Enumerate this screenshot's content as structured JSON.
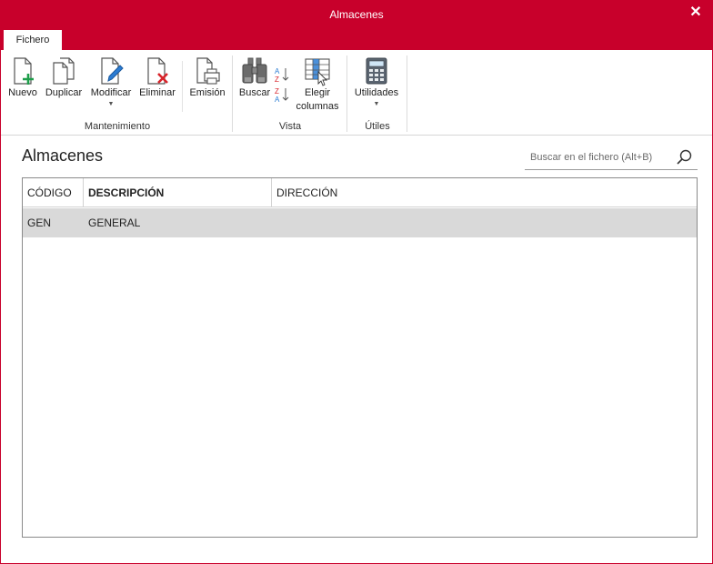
{
  "window": {
    "title": "Almacenes",
    "close_glyph": "✕"
  },
  "tabs": [
    {
      "label": "Fichero"
    }
  ],
  "ribbon": {
    "groups": [
      {
        "label": "Mantenimiento"
      },
      {
        "label": "Vista"
      },
      {
        "label": "Útiles"
      }
    ],
    "buttons": {
      "nuevo": {
        "label": "Nuevo",
        "icon": "new-document-icon"
      },
      "duplicar": {
        "label": "Duplicar",
        "icon": "duplicate-icon"
      },
      "modificar": {
        "label": "Modificar",
        "icon": "edit-document-icon"
      },
      "eliminar": {
        "label": "Eliminar",
        "icon": "delete-document-icon"
      },
      "emision": {
        "label": "Emisión",
        "icon": "print-icon"
      },
      "buscar": {
        "label": "Buscar",
        "icon": "binoculars-icon"
      },
      "sort_asc": {
        "icon": "sort-ascending-icon"
      },
      "sort_desc": {
        "icon": "sort-descending-icon"
      },
      "elegir_columnas": {
        "label_line1": "Elegir",
        "label_line2": "columnas",
        "icon": "choose-columns-icon"
      },
      "utilidades": {
        "label": "Utilidades",
        "icon": "calculator-icon"
      }
    }
  },
  "page": {
    "heading": "Almacenes"
  },
  "search": {
    "placeholder": "Buscar en el fichero (Alt+B)",
    "value": ""
  },
  "table": {
    "columns": [
      "CÓDIGO",
      "DESCRIPCIÓN",
      "DIRECCIÓN"
    ],
    "rows": [
      [
        "GEN",
        "GENERAL",
        ""
      ]
    ]
  },
  "colors": {
    "accent": "#c8002b",
    "selected_row": "#d9d9d9",
    "icon_green": "#1e9e4a",
    "icon_red": "#d8232a",
    "icon_blue": "#2b7cd3"
  }
}
